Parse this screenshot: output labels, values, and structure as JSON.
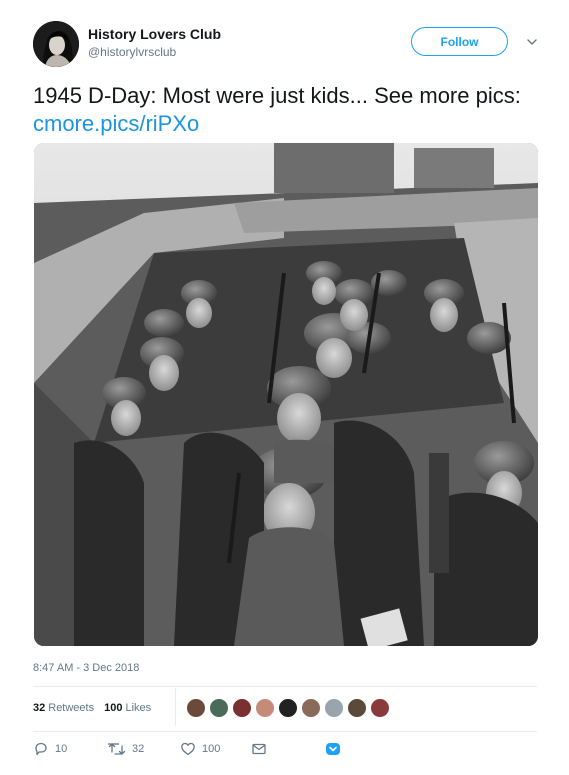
{
  "account": {
    "name": "History Lovers Club",
    "handle": "@historylvrsclub"
  },
  "header": {
    "follow_label": "Follow"
  },
  "tweet": {
    "text_prefix": "1945 D-Day: Most were just kids... See more pics: ",
    "link_text": "cmore.pics/riPXo",
    "timestamp": "8:47 AM - 3 Dec 2018"
  },
  "stats": {
    "retweets_count": "32",
    "retweets_label": "Retweets",
    "likes_count": "100",
    "likes_label": "Likes"
  },
  "actions": {
    "reply_count": "10",
    "retweet_count": "32",
    "like_count": "100"
  },
  "icons": {
    "reply": "reply-icon",
    "retweet": "retweet-icon",
    "like": "heart-icon",
    "dm": "envelope-icon",
    "more": "chevron-down-icon"
  },
  "colors": {
    "accent": "#1da1f2",
    "link": "#1b95e0",
    "secondary_text": "#657786",
    "text": "#14171a"
  }
}
